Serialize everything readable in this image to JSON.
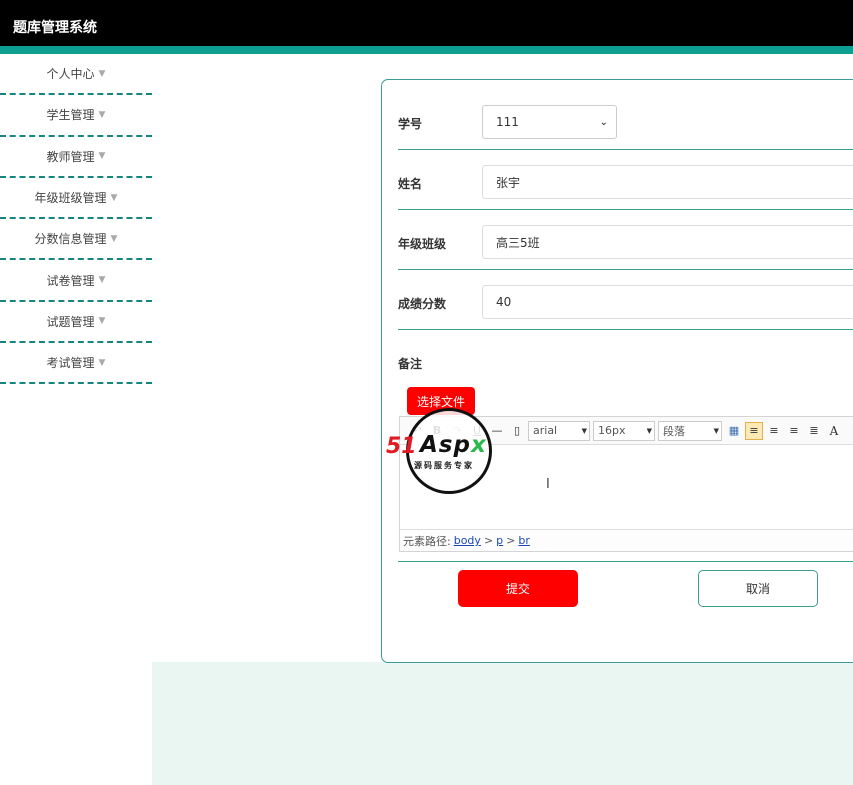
{
  "app": {
    "title": "题库管理系统"
  },
  "sidebar": {
    "items": [
      {
        "label": "个人中心"
      },
      {
        "label": "学生管理"
      },
      {
        "label": "教师管理"
      },
      {
        "label": "年级班级管理"
      },
      {
        "label": "分数信息管理"
      },
      {
        "label": "试卷管理"
      },
      {
        "label": "试题管理"
      },
      {
        "label": "考试管理"
      }
    ]
  },
  "form": {
    "student_id": {
      "label": "学号",
      "value": "111"
    },
    "name": {
      "label": "姓名",
      "value": "张宇"
    },
    "grade_class": {
      "label": "年级班级",
      "value": "高三5班"
    },
    "score": {
      "label": "成绩分数",
      "value": "40"
    },
    "remark": {
      "label": "备注"
    },
    "file_button": "选择文件",
    "editor": {
      "font_family": "arial",
      "font_size": "16px",
      "paragraph": "段落",
      "path_label": "元素路径:",
      "path": [
        "body",
        "p",
        "br"
      ],
      "path_sep": ">"
    },
    "submit_label": "提交",
    "cancel_label": "取消"
  },
  "watermark": {
    "num": "51",
    "brand_a": "Asp",
    "brand_x": "x",
    "subtitle": "源码服务专家"
  }
}
